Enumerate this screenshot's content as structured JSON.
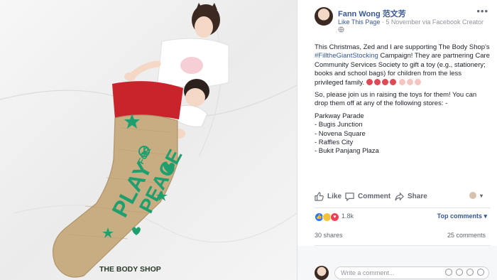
{
  "photo": {
    "stocking_text_play": "PLAY",
    "stocking_text_for": "FOR",
    "stocking_text_peace": "PEACE",
    "stocking_brand": "THE BODY SHOP"
  },
  "post": {
    "author": "Fann Wong 范文芳",
    "like_page": "Like This Page",
    "separator": "·",
    "date": "5 November via Facebook Creator",
    "paragraph1_start": "This Christmas, Zed and I are supporting The Body Shop's ",
    "hashtag": "#FilltheGiantStocking",
    "paragraph1_end": " Campaign! They are partnering Care Community Services Society to gift a toy (e.g., stationery; books and school bags) for children from the less privileged family.",
    "paragraph2": "So, please join us in raising the toys for them! You can drop them off at any of the following stores: -",
    "stores": [
      "Parkway Parade",
      "- Bugis Junction",
      "- Novena Square",
      "- Raffles City",
      "- Bukit Panjang Plaza"
    ]
  },
  "actions": {
    "like": "Like",
    "comment": "Comment",
    "share": "Share"
  },
  "stats": {
    "reaction_count": "1.8k",
    "top_comments": "Top comments ▾",
    "shares": "30 shares",
    "comments": "25 comments"
  },
  "composer": {
    "placeholder": "Write a comment..."
  },
  "icons": {
    "more": "more-icon",
    "globe": "globe-icon",
    "like": "thumbs-up-icon",
    "comment": "speech-bubble-icon",
    "share": "share-arrow-icon"
  },
  "colors": {
    "link": "#385898",
    "stocking_green": "#1f9e6e",
    "stocking_red": "#c9242c",
    "burlap": "#c9ad82"
  }
}
